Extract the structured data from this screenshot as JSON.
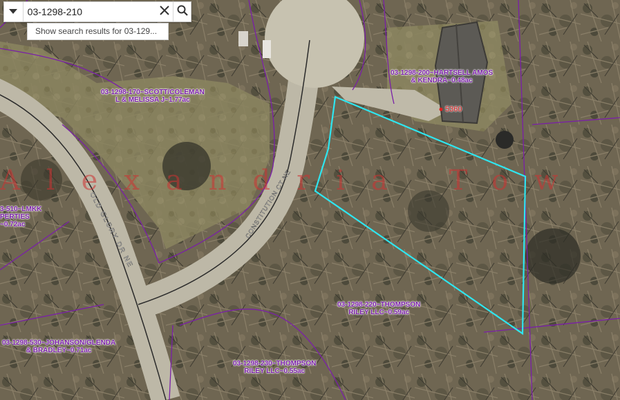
{
  "search": {
    "value": "03-1298-210",
    "suggestion": "Show search results for 03-129..."
  },
  "watermark": "Alexandria Tow",
  "parcels": [
    {
      "line1": "03-1298-170~SCOTT/COLEMAN",
      "line2": "L & MELISSA J~1.77ac"
    },
    {
      "line1": "03-1298-200~HARTSELL AMOS",
      "line2": "& KENDRA~0.48ac"
    },
    {
      "line1": "03-1298-220~THOMPSON",
      "line2": "RILEY LLC~0.59ac"
    },
    {
      "line1": "03-1298-230~THOMPSON",
      "line2": "RILEY LLC~0.55ac"
    },
    {
      "line1": "03-1298-530~JOHANSON/GLENDA",
      "line2": "& BRADLEY~0.71ac"
    },
    {
      "line1": "3-510~LMKK",
      "line2": "PERTIES",
      "line3": "~0.72ac"
    }
  ],
  "address": "5360",
  "streets": {
    "glory": "OLD GLORY DR NE",
    "constitution": "CONSTITUTION CT NE"
  },
  "colors": {
    "parcel_line": "#7a1fa8",
    "selected_outline": "#2ee6f0",
    "address_dot": "#e02020"
  },
  "icons": {
    "dropdown": "caret-down-icon",
    "clear": "close-icon",
    "search": "magnifier-icon"
  }
}
